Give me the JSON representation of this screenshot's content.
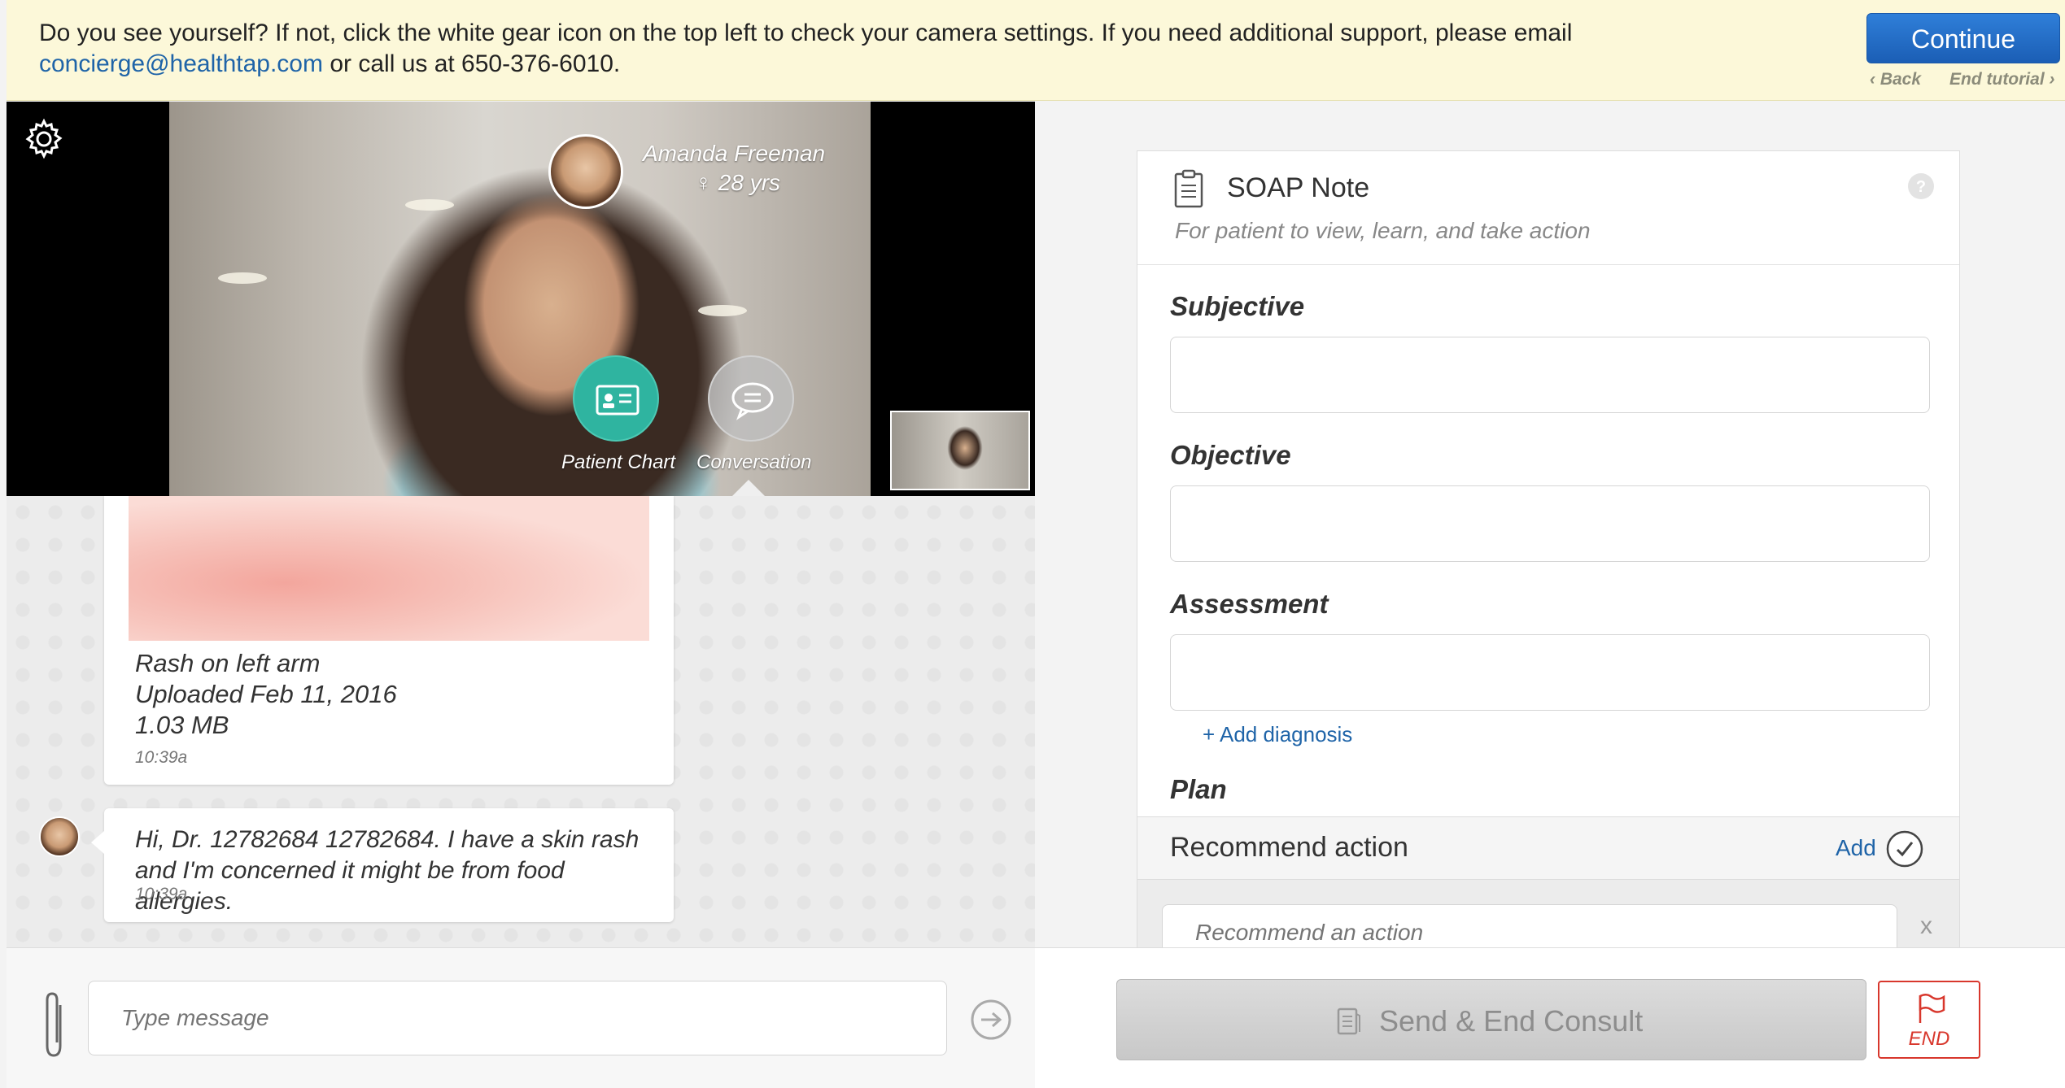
{
  "banner": {
    "message": "Do you see yourself? If not, click the white gear icon on the top left to check your camera settings. If you need additional support, please email",
    "email": "concierge@healthtap.com",
    "message_tail": "or call us at 650-376-6010.",
    "continue_label": "Continue",
    "back_label": "‹ Back",
    "end_tutorial_label": "End tutorial ›"
  },
  "video": {
    "patient_name": "Amanda Freeman",
    "patient_age": "♀ 28 yrs",
    "patient_chart_label": "Patient Chart",
    "conversation_label": "Conversation",
    "icons": [
      "gear-icon",
      "id-card-icon",
      "speech-bubble-icon"
    ]
  },
  "chat": {
    "photo_card": {
      "caption": "Rash on left arm",
      "uploaded": "Uploaded Feb 11, 2016",
      "size": "1.03 MB",
      "time": "10:39a"
    },
    "message": {
      "text": "Hi, Dr. 12782684 12782684. I have a skin rash and I'm concerned it might be from food allergies.",
      "time": "10:39a"
    }
  },
  "compose": {
    "placeholder": "Type message",
    "icons": [
      "paperclip-icon",
      "send-arrow-icon"
    ]
  },
  "soap": {
    "title": "SOAP Note",
    "subtitle": "For patient to view, learn, and take action",
    "subjective_label": "Subjective",
    "objective_label": "Objective",
    "assessment_label": "Assessment",
    "add_diagnosis_label": "+ Add diagnosis",
    "plan_label": "Plan",
    "recommend_title": "Recommend action",
    "recommend_add_label": "Add",
    "recommend_placeholder": "Recommend an action",
    "remove_label": "x"
  },
  "actions": {
    "send_end_label": "Send & End Consult",
    "end_label": "END"
  },
  "colors": {
    "banner_bg": "#fcf8d9",
    "primary_blue": "#1f64a8",
    "teal": "#2fb4a0",
    "end_red": "#d8372c"
  }
}
